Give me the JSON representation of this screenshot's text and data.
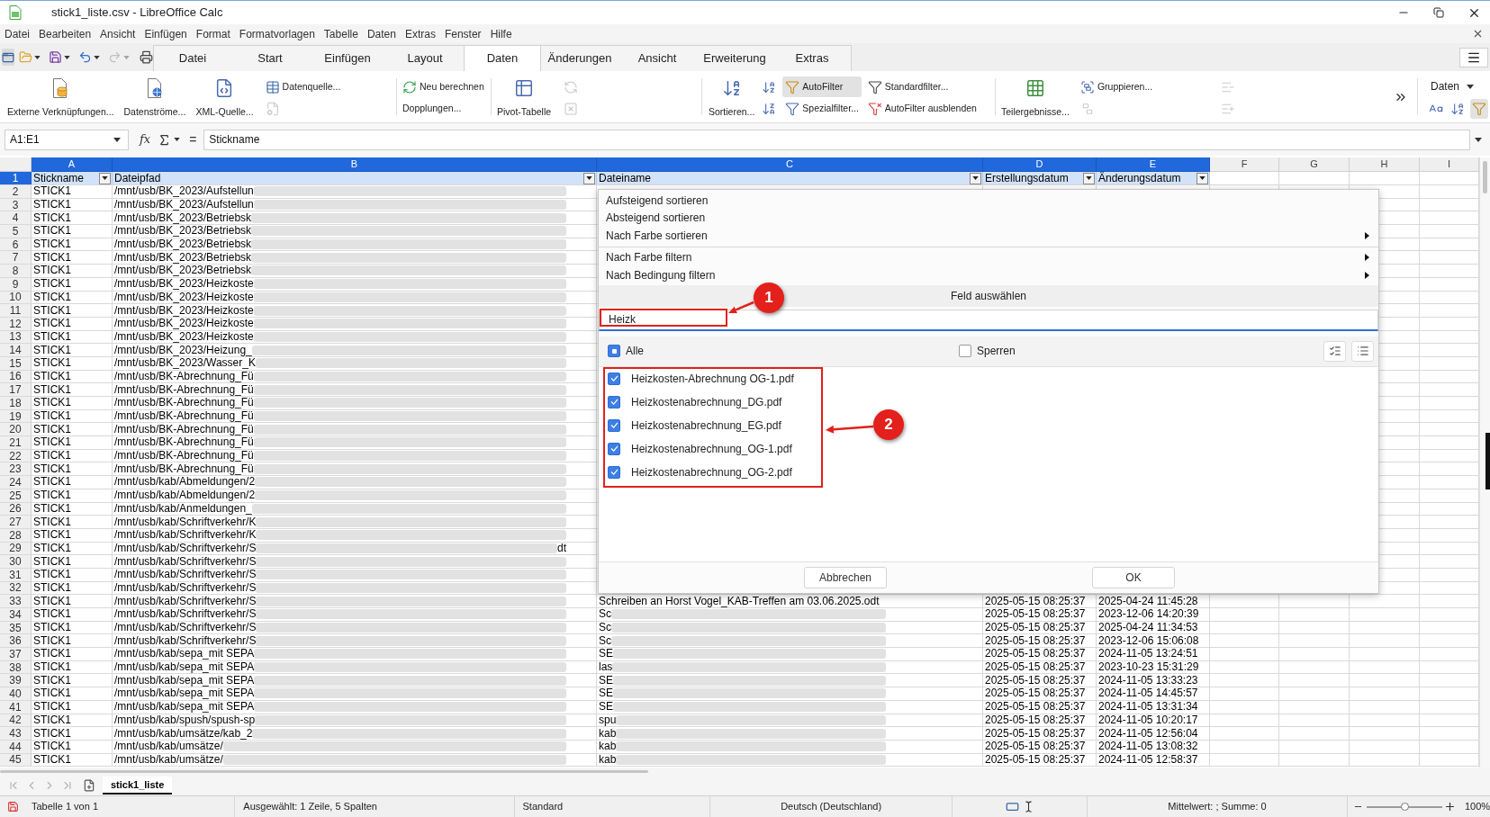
{
  "window": {
    "title": "stick1_liste.csv - LibreOffice Calc"
  },
  "menu_bar": [
    "Datei",
    "Bearbeiten",
    "Ansicht",
    "Einfügen",
    "Format",
    "Formatvorlagen",
    "Tabelle",
    "Daten",
    "Extras",
    "Fenster",
    "Hilfe"
  ],
  "ribbon_tabs": [
    {
      "label": "Datei",
      "selected": false
    },
    {
      "label": "Start",
      "selected": false
    },
    {
      "label": "Einfügen",
      "selected": false
    },
    {
      "label": "Layout",
      "selected": false
    },
    {
      "label": "Daten",
      "selected": true
    },
    {
      "label": "Änderungen",
      "selected": false
    },
    {
      "label": "Ansicht",
      "selected": false
    },
    {
      "label": "Erweiterung",
      "selected": false
    },
    {
      "label": "Extras",
      "selected": false
    }
  ],
  "ribbon": {
    "groups": [
      {
        "columns": [
          {
            "kind": "large",
            "label": "Externe Verknüpfungen..."
          },
          {
            "kind": "large",
            "label": "Datenströme..."
          },
          {
            "kind": "large",
            "label": "XML-Quelle..."
          },
          {
            "kind": "stack",
            "items": [
              {
                "label": "Datenquelle...",
                "disabled": false,
                "pressed": false
              },
              {
                "disabled": true,
                "pressed": false
              }
            ]
          }
        ]
      },
      {
        "columns": [
          {
            "kind": "stack",
            "items": [
              {
                "label": "Neu berechnen",
                "disabled": false,
                "pressed": false
              },
              {
                "label": "Dopplungen...",
                "disabled": false,
                "pressed": false
              }
            ]
          }
        ]
      },
      {
        "columns": [
          {
            "kind": "large",
            "label": "Pivot-Tabelle"
          },
          {
            "kind": "stack",
            "items": [
              {
                "disabled": true,
                "pressed": false
              },
              {
                "disabled": true,
                "pressed": false
              }
            ]
          }
        ]
      },
      {
        "columns": [
          {
            "kind": "large",
            "label": "Sortieren..."
          },
          {
            "kind": "stack",
            "items": [
              {
                "disabled": false,
                "pressed": false
              },
              {
                "disabled": false,
                "pressed": false
              }
            ]
          },
          {
            "kind": "stack",
            "items": [
              {
                "label": "AutoFilter",
                "disabled": false,
                "pressed": true
              },
              {
                "label": "Spezialfilter...",
                "disabled": false,
                "pressed": false
              }
            ]
          },
          {
            "kind": "stack",
            "items": [
              {
                "label": "Standardfilter...",
                "disabled": false,
                "pressed": false
              },
              {
                "label": "AutoFilter ausblenden",
                "disabled": false,
                "pressed": false
              }
            ]
          }
        ]
      },
      {
        "columns": [
          {
            "kind": "large",
            "label": "Teilergebnisse..."
          },
          {
            "kind": "stack",
            "items": [
              {
                "label": "Gruppieren...",
                "disabled": false,
                "pressed": false
              },
              {
                "disabled": true,
                "pressed": false
              }
            ]
          },
          {
            "kind": "stack",
            "items": [
              {
                "disabled": true,
                "pressed": false
              },
              {
                "disabled": true,
                "pressed": false
              }
            ]
          }
        ]
      }
    ],
    "deck": {
      "label": "Daten",
      "tools": [
        {
          "pressed": false
        },
        {
          "pressed": false
        },
        {
          "pressed": true
        }
      ]
    }
  },
  "formula_bar": {
    "name_box": "A1:E1",
    "function_label": "fx",
    "equals": "=",
    "content": "Stickname"
  },
  "sheet": {
    "columns": [
      {
        "label": "A",
        "selected": true
      },
      {
        "label": "B",
        "selected": true
      },
      {
        "label": "C",
        "selected": true
      },
      {
        "label": "D",
        "selected": true
      },
      {
        "label": "E",
        "selected": true
      },
      {
        "label": "F",
        "selected": false
      },
      {
        "label": "G",
        "selected": false
      },
      {
        "label": "H",
        "selected": false
      },
      {
        "label": "I",
        "selected": false
      }
    ],
    "header_row": {
      "number": "1",
      "selected": true,
      "cells": [
        "Stickname",
        "Dateipfad",
        "Dateiname",
        "Erstellungsdatum",
        "Änderungsdatum"
      ]
    },
    "rows": [
      {
        "number": "2",
        "selected": false,
        "cells": [
          {
            "text": "STICK1",
            "blurred": false
          },
          {
            "text": "/mnt/usb/BK_2023/Aufstellun",
            "blurred": true
          }
        ]
      },
      {
        "number": "3",
        "selected": false,
        "cells": [
          {
            "text": "STICK1",
            "blurred": false
          },
          {
            "text": "/mnt/usb/BK_2023/Aufstellun",
            "blurred": true
          }
        ]
      },
      {
        "number": "4",
        "selected": false,
        "cells": [
          {
            "text": "STICK1",
            "blurred": false
          },
          {
            "text": "/mnt/usb/BK_2023/Betriebsk",
            "blurred": true
          }
        ]
      },
      {
        "number": "5",
        "selected": false,
        "cells": [
          {
            "text": "STICK1",
            "blurred": false
          },
          {
            "text": "/mnt/usb/BK_2023/Betriebsk",
            "blurred": true
          }
        ]
      },
      {
        "number": "6",
        "selected": false,
        "cells": [
          {
            "text": "STICK1",
            "blurred": false
          },
          {
            "text": "/mnt/usb/BK_2023/Betriebsk",
            "blurred": true
          }
        ]
      },
      {
        "number": "7",
        "selected": false,
        "cells": [
          {
            "text": "STICK1",
            "blurred": false
          },
          {
            "text": "/mnt/usb/BK_2023/Betriebsk",
            "blurred": true
          }
        ]
      },
      {
        "number": "8",
        "selected": false,
        "cells": [
          {
            "text": "STICK1",
            "blurred": false
          },
          {
            "text": "/mnt/usb/BK_2023/Betriebsk",
            "blurred": true
          }
        ]
      },
      {
        "number": "9",
        "selected": false,
        "cells": [
          {
            "text": "STICK1",
            "blurred": false
          },
          {
            "text": "/mnt/usb/BK_2023/Heizkoste",
            "blurred": true
          }
        ]
      },
      {
        "number": "10",
        "selected": false,
        "cells": [
          {
            "text": "STICK1",
            "blurred": false
          },
          {
            "text": "/mnt/usb/BK_2023/Heizkoste",
            "blurred": true
          }
        ]
      },
      {
        "number": "11",
        "selected": false,
        "cells": [
          {
            "text": "STICK1",
            "blurred": false
          },
          {
            "text": "/mnt/usb/BK_2023/Heizkoste",
            "blurred": true
          }
        ]
      },
      {
        "number": "12",
        "selected": false,
        "cells": [
          {
            "text": "STICK1",
            "blurred": false
          },
          {
            "text": "/mnt/usb/BK_2023/Heizkoste",
            "blurred": true
          }
        ]
      },
      {
        "number": "13",
        "selected": false,
        "cells": [
          {
            "text": "STICK1",
            "blurred": false
          },
          {
            "text": "/mnt/usb/BK_2023/Heizkoste",
            "blurred": true
          }
        ]
      },
      {
        "number": "14",
        "selected": false,
        "cells": [
          {
            "text": "STICK1",
            "blurred": false
          },
          {
            "text": "/mnt/usb/BK_2023/Heizung_",
            "blurred": true
          }
        ]
      },
      {
        "number": "15",
        "selected": false,
        "cells": [
          {
            "text": "STICK1",
            "blurred": false
          },
          {
            "text": "/mnt/usb/BK_2023/Wasser_K",
            "blurred": true
          }
        ]
      },
      {
        "number": "16",
        "selected": false,
        "cells": [
          {
            "text": "STICK1",
            "blurred": false
          },
          {
            "text": "/mnt/usb/BK-Abrechnung_Fü",
            "blurred": true
          }
        ]
      },
      {
        "number": "17",
        "selected": false,
        "cells": [
          {
            "text": "STICK1",
            "blurred": false
          },
          {
            "text": "/mnt/usb/BK-Abrechnung_Fü",
            "blurred": true
          }
        ]
      },
      {
        "number": "18",
        "selected": false,
        "cells": [
          {
            "text": "STICK1",
            "blurred": false
          },
          {
            "text": "/mnt/usb/BK-Abrechnung_Fü",
            "blurred": true
          }
        ]
      },
      {
        "number": "19",
        "selected": false,
        "cells": [
          {
            "text": "STICK1",
            "blurred": false
          },
          {
            "text": "/mnt/usb/BK-Abrechnung_Fü",
            "blurred": true
          }
        ]
      },
      {
        "number": "20",
        "selected": false,
        "cells": [
          {
            "text": "STICK1",
            "blurred": false
          },
          {
            "text": "/mnt/usb/BK-Abrechnung_Fü",
            "blurred": true
          }
        ]
      },
      {
        "number": "21",
        "selected": false,
        "cells": [
          {
            "text": "STICK1",
            "blurred": false
          },
          {
            "text": "/mnt/usb/BK-Abrechnung_Fü",
            "blurred": true
          }
        ]
      },
      {
        "number": "22",
        "selected": false,
        "cells": [
          {
            "text": "STICK1",
            "blurred": false
          },
          {
            "text": "/mnt/usb/BK-Abrechnung_Fü",
            "blurred": true
          }
        ]
      },
      {
        "number": "23",
        "selected": false,
        "cells": [
          {
            "text": "STICK1",
            "blurred": false
          },
          {
            "text": "/mnt/usb/BK-Abrechnung_Fü",
            "blurred": true
          }
        ]
      },
      {
        "number": "24",
        "selected": false,
        "cells": [
          {
            "text": "STICK1",
            "blurred": false
          },
          {
            "text": "/mnt/usb/kab/Abmeldungen/2",
            "blurred": true
          }
        ]
      },
      {
        "number": "25",
        "selected": false,
        "cells": [
          {
            "text": "STICK1",
            "blurred": false
          },
          {
            "text": "/mnt/usb/kab/Abmeldungen/2",
            "blurred": true
          }
        ]
      },
      {
        "number": "26",
        "selected": false,
        "cells": [
          {
            "text": "STICK1",
            "blurred": false
          },
          {
            "text": "/mnt/usb/kab/Anmeldungen_",
            "blurred": true
          }
        ]
      },
      {
        "number": "27",
        "selected": false,
        "cells": [
          {
            "text": "STICK1",
            "blurred": false
          },
          {
            "text": "/mnt/usb/kab/Schriftverkehr/K",
            "blurred": true
          }
        ]
      },
      {
        "number": "28",
        "selected": false,
        "cells": [
          {
            "text": "STICK1",
            "blurred": false
          },
          {
            "text": "/mnt/usb/kab/Schriftverkehr/K",
            "blurred": true
          }
        ]
      },
      {
        "number": "29",
        "selected": false,
        "cells": [
          {
            "text": "STICK1",
            "blurred": false
          },
          {
            "text": "/mnt/usb/kab/Schriftverkehr/S",
            "blurred": true,
            "tail": "dt"
          }
        ]
      },
      {
        "number": "30",
        "selected": false,
        "cells": [
          {
            "text": "STICK1",
            "blurred": false
          },
          {
            "text": "/mnt/usb/kab/Schriftverkehr/S",
            "blurred": true
          }
        ]
      },
      {
        "number": "31",
        "selected": false,
        "cells": [
          {
            "text": "STICK1",
            "blurred": false
          },
          {
            "text": "/mnt/usb/kab/Schriftverkehr/S",
            "blurred": true
          }
        ]
      },
      {
        "number": "32",
        "selected": false,
        "cells": [
          {
            "text": "STICK1",
            "blurred": false
          },
          {
            "text": "/mnt/usb/kab/Schriftverkehr/S",
            "blurred": true
          }
        ]
      },
      {
        "number": "33",
        "selected": false,
        "cells": [
          {
            "text": "STICK1",
            "blurred": false
          },
          {
            "text": "/mnt/usb/kab/Schriftverkehr/S",
            "blurred": true
          },
          {
            "text": "Schreiben an Horst Vogel_KAB-Treffen am 03.06.2025.odt",
            "blurred": false
          },
          {
            "text": "2025-05-15 08:25:37",
            "blurred": false
          },
          {
            "text": "2025-04-24 11:45:28",
            "blurred": false
          }
        ]
      },
      {
        "number": "34",
        "selected": false,
        "cells": [
          {
            "text": "STICK1",
            "blurred": false
          },
          {
            "text": "/mnt/usb/kab/Schriftverkehr/S",
            "blurred": true
          },
          {
            "text": "Sc",
            "blurred": true
          },
          {
            "text": "2025-05-15 08:25:37",
            "blurred": false
          },
          {
            "text": "2023-12-06 14:20:39",
            "blurred": false
          }
        ]
      },
      {
        "number": "35",
        "selected": false,
        "cells": [
          {
            "text": "STICK1",
            "blurred": false
          },
          {
            "text": "/mnt/usb/kab/Schriftverkehr/S",
            "blurred": true
          },
          {
            "text": "Sc",
            "blurred": true
          },
          {
            "text": "2025-05-15 08:25:37",
            "blurred": false
          },
          {
            "text": "2025-04-24 11:34:53",
            "blurred": false
          }
        ]
      },
      {
        "number": "36",
        "selected": false,
        "cells": [
          {
            "text": "STICK1",
            "blurred": false
          },
          {
            "text": "/mnt/usb/kab/Schriftverkehr/S",
            "blurred": true
          },
          {
            "text": "Sc",
            "blurred": true
          },
          {
            "text": "2025-05-15 08:25:37",
            "blurred": false
          },
          {
            "text": "2023-12-06 15:06:08",
            "blurred": false
          }
        ]
      },
      {
        "number": "37",
        "selected": false,
        "cells": [
          {
            "text": "STICK1",
            "blurred": false
          },
          {
            "text": "/mnt/usb/kab/sepa_mit SEPA",
            "blurred": true
          },
          {
            "text": "SE",
            "blurred": true
          },
          {
            "text": "2025-05-15 08:25:37",
            "blurred": false
          },
          {
            "text": "2024-11-05 13:24:51",
            "blurred": false
          }
        ]
      },
      {
        "number": "38",
        "selected": false,
        "cells": [
          {
            "text": "STICK1",
            "blurred": false
          },
          {
            "text": "/mnt/usb/kab/sepa_mit SEPA",
            "blurred": true
          },
          {
            "text": "las",
            "blurred": true
          },
          {
            "text": "2025-05-15 08:25:37",
            "blurred": false
          },
          {
            "text": "2023-10-23 15:31:29",
            "blurred": false
          }
        ]
      },
      {
        "number": "39",
        "selected": false,
        "cells": [
          {
            "text": "STICK1",
            "blurred": false
          },
          {
            "text": "/mnt/usb/kab/sepa_mit SEPA",
            "blurred": true
          },
          {
            "text": "SE",
            "blurred": true
          },
          {
            "text": "2025-05-15 08:25:37",
            "blurred": false
          },
          {
            "text": "2024-11-05 13:33:23",
            "blurred": false
          }
        ]
      },
      {
        "number": "40",
        "selected": false,
        "cells": [
          {
            "text": "STICK1",
            "blurred": false
          },
          {
            "text": "/mnt/usb/kab/sepa_mit SEPA",
            "blurred": true
          },
          {
            "text": "SE",
            "blurred": true
          },
          {
            "text": "2025-05-15 08:25:37",
            "blurred": false
          },
          {
            "text": "2024-11-05 14:45:57",
            "blurred": false
          }
        ]
      },
      {
        "number": "41",
        "selected": false,
        "cells": [
          {
            "text": "STICK1",
            "blurred": false
          },
          {
            "text": "/mnt/usb/kab/sepa_mit SEPA",
            "blurred": true
          },
          {
            "text": "SE",
            "blurred": true
          },
          {
            "text": "2025-05-15 08:25:37",
            "blurred": false
          },
          {
            "text": "2024-11-05 13:31:34",
            "blurred": false
          }
        ]
      },
      {
        "number": "42",
        "selected": false,
        "cells": [
          {
            "text": "STICK1",
            "blurred": false
          },
          {
            "text": "/mnt/usb/kab/spush/spush-sp",
            "blurred": true
          },
          {
            "text": "spu",
            "blurred": true
          },
          {
            "text": "2025-05-15 08:25:37",
            "blurred": false
          },
          {
            "text": "2024-11-05 10:20:17",
            "blurred": false
          }
        ]
      },
      {
        "number": "43",
        "selected": false,
        "cells": [
          {
            "text": "STICK1",
            "blurred": false
          },
          {
            "text": "/mnt/usb/kab/umsätze/kab_2",
            "blurred": true
          },
          {
            "text": "kab",
            "blurred": true
          },
          {
            "text": "2025-05-15 08:25:37",
            "blurred": false
          },
          {
            "text": "2024-11-05 12:56:04",
            "blurred": false
          }
        ]
      },
      {
        "number": "44",
        "selected": false,
        "cells": [
          {
            "text": "STICK1",
            "blurred": false
          },
          {
            "text": "/mnt/usb/kab/umsätze/",
            "blurred": true
          },
          {
            "text": "kab",
            "blurred": true
          },
          {
            "text": "2025-05-15 08:25:37",
            "blurred": false
          },
          {
            "text": "2024-11-05 13:08:32",
            "blurred": false
          }
        ]
      },
      {
        "number": "45",
        "selected": false,
        "cells": [
          {
            "text": "STICK1",
            "blurred": false
          },
          {
            "text": "/mnt/usb/kab/umsätze/",
            "blurred": true
          },
          {
            "text": "kab",
            "blurred": true
          },
          {
            "text": "2025-05-15 08:25:37",
            "blurred": false
          },
          {
            "text": "2024-11-05 12:58:37",
            "blurred": false
          }
        ]
      }
    ]
  },
  "autofilter_popup": {
    "sort_menu": [
      {
        "label": "Aufsteigend sortieren",
        "submenu": false
      },
      {
        "label": "Absteigend sortieren",
        "submenu": false
      },
      {
        "label": "Nach Farbe sortieren",
        "submenu": true
      }
    ],
    "filter_menu": [
      {
        "label": "Nach Farbe filtern",
        "submenu": true
      },
      {
        "label": "Nach Bedingung filtern",
        "submenu": true
      }
    ],
    "field_label": "Feld auswählen",
    "search": {
      "value": "Heizk"
    },
    "all": {
      "label": "Alle",
      "indeterminate": true
    },
    "lock": {
      "label": "Sperren",
      "checked": false
    },
    "items": [
      {
        "label": "Heizkosten-Abrechnung OG-1.pdf",
        "checked": true
      },
      {
        "label": "Heizkostenabrechnung_DG.pdf",
        "checked": true
      },
      {
        "label": "Heizkostenabrechnung_EG.pdf",
        "checked": true
      },
      {
        "label": "Heizkostenabrechnung_OG-1.pdf",
        "checked": true
      },
      {
        "label": "Heizkostenabrechnung_OG-2.pdf",
        "checked": true
      }
    ],
    "buttons": [
      "Abbrechen",
      "OK"
    ]
  },
  "annotations": [
    {
      "number": "1"
    },
    {
      "number": "2"
    }
  ],
  "sheet_tabs": [
    {
      "label": "stick1_liste",
      "selected": true
    }
  ],
  "status_bar": {
    "sheet_info": "Tabelle 1 von 1",
    "selection": "Ausgewählt: 1 Zeile, 5 Spalten",
    "page_style": "Standard",
    "language": "Deutsch (Deutschland)",
    "summary": "Mittelwert: ; Summe: 0",
    "zoom_slider": {
      "level": 0.5
    },
    "zoom": "100%"
  }
}
